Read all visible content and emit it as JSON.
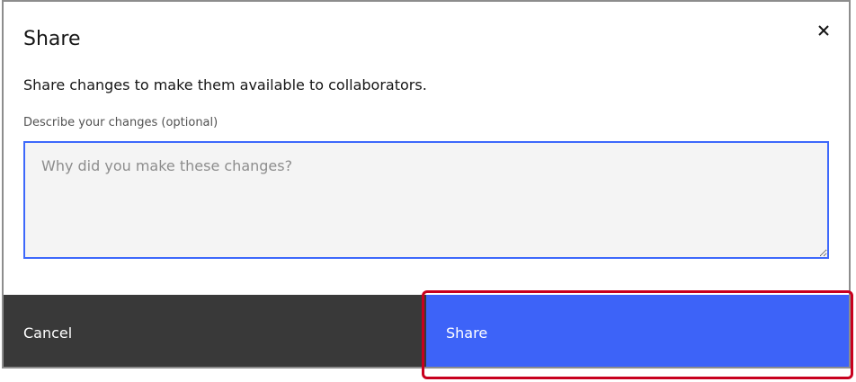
{
  "dialog": {
    "title": "Share",
    "description": "Share changes to make them available to collaborators.",
    "field_label": "Describe your changes (optional)",
    "textarea_value": "",
    "textarea_placeholder": "Why did you make these changes?"
  },
  "footer": {
    "cancel_label": "Cancel",
    "share_label": "Share"
  },
  "icons": {
    "close": "close-icon"
  },
  "colors": {
    "primary": "#3d63f8",
    "secondary": "#393939",
    "focus_border": "#3d68fb",
    "highlight": "#c8001e"
  }
}
